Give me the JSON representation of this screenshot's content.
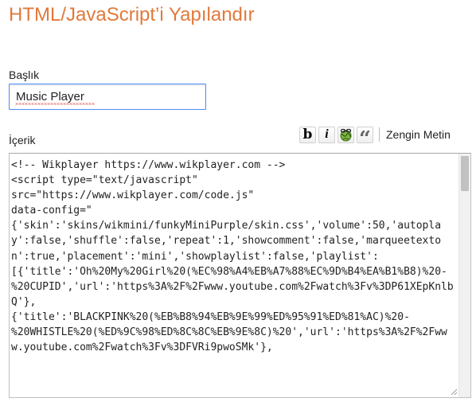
{
  "dialog": {
    "title": "HTML/JavaScript’i Yapılandır"
  },
  "title_field": {
    "label": "Başlık",
    "value": "Music Player"
  },
  "content_field": {
    "label": "İçerik",
    "value": "<!-- Wikplayer https://www.wikplayer.com -->\n<script type=\"text/javascript\"\nsrc=\"https://www.wikplayer.com/code.js\"\ndata-config=\"\n{'skin':'skins/wikmini/funkyMiniPurple/skin.css','volume':50,'autoplay':false,'shuffle':false,'repeat':1,'showcomment':false,'marqueetexton':true,'placement':'mini','showplaylist':false,'playlist':\n[{'title':'Oh%20My%20Girl%20(%EC%98%A4%EB%A7%88%EC%9D%B4%EA%B1%B8)%20-\n%20CUPID','url':'https%3A%2F%2Fwww.youtube.com%2Fwatch%3Fv%3DP61XEpKnlbQ'},\n{'title':'BLACKPINK%20(%EB%B8%94%EB%9E%99%ED%95%91%ED%81%AC)%20-\n%20WHISTLE%20(%ED%9C%98%ED%8C%8C%EB%9E%8C)%20','url':'https%3A%2F%2Fwww.youtube.com%2Fwatch%3Fv%3DFVRi9pwoSMk'},"
  },
  "toolbar": {
    "bold_label": "b",
    "italic_label": "i",
    "link_icon": "globe-link-icon",
    "quote_label": "“",
    "rich_text_label": "Zengin Metin"
  },
  "colors": {
    "title": "#e1793b",
    "input_focus_border": "#4d90fe"
  }
}
